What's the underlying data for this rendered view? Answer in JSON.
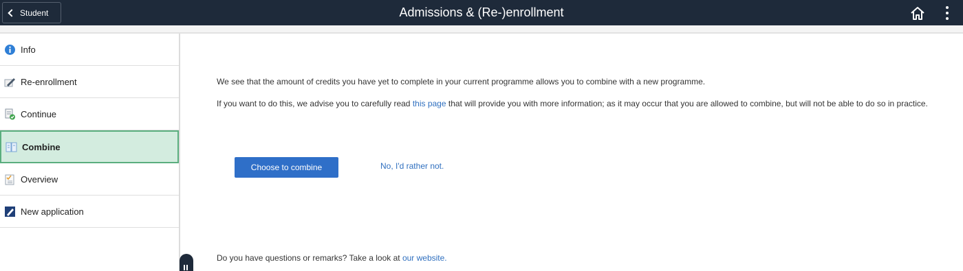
{
  "header": {
    "back_label": "Student",
    "title": "Admissions & (Re-)enrollment",
    "home_icon": "home-icon",
    "more_icon": "more-vertical-icon"
  },
  "sidebar": {
    "items": [
      {
        "label": "Info",
        "icon": "info-icon",
        "active": false
      },
      {
        "label": "Re-enrollment",
        "icon": "edit-pen-icon",
        "active": false
      },
      {
        "label": "Continue",
        "icon": "document-check-icon",
        "active": false
      },
      {
        "label": "Combine",
        "icon": "book-icon",
        "active": true
      },
      {
        "label": "Overview",
        "icon": "checklist-icon",
        "active": false
      },
      {
        "label": "New application",
        "icon": "new-application-icon",
        "active": false
      }
    ]
  },
  "main": {
    "paragraph1": "We see that the amount of credits you have yet to complete in your current programme allows you to combine with a new programme.",
    "paragraph2_before": "If you want to do this, we advise you to carefully read ",
    "paragraph2_link": "this page",
    "paragraph2_after": " that will provide you with more information; as it may occur that you are allowed to combine, but will not be able to do so in practice.",
    "combine_button": "Choose to combine",
    "decline_link": "No, I'd rather not.",
    "footer_before": "Do you have questions or remarks? Take a look at ",
    "footer_link": "our website."
  },
  "colors": {
    "header_bg": "#1e2a3a",
    "active_bg": "#d3ecdf",
    "active_border": "#5aae7e",
    "primary_button": "#2f6fc8",
    "link": "#2f6fbf"
  }
}
